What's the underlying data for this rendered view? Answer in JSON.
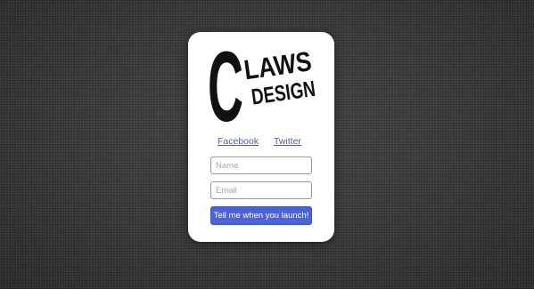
{
  "brand": {
    "logo_letter": "C",
    "logo_word_top": "LAWS",
    "logo_word_bottom": "DESIGN",
    "text_color": "#111111"
  },
  "social": {
    "facebook_label": "Facebook",
    "twitter_label": "Twitter",
    "link_color": "#4a5db8"
  },
  "form": {
    "name_placeholder": "Name",
    "name_value": "",
    "email_placeholder": "Email",
    "email_value": "",
    "submit_label": "Tell me when you launch!",
    "button_color": "#4a63dd"
  },
  "theme": {
    "background_color": "#3a3a3a",
    "card_color": "#ffffff"
  }
}
